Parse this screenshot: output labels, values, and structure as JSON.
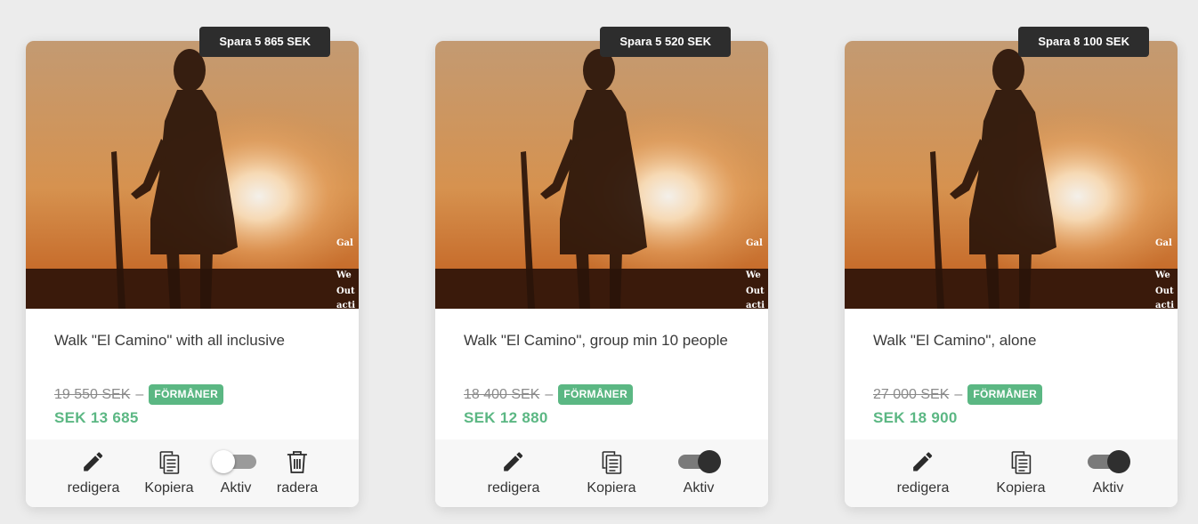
{
  "colors": {
    "accent_green": "#5bb783",
    "badge_dark": "#2d2d2d",
    "text": "#3a3a3a"
  },
  "cards": [
    {
      "save_badge": "Spara 5 865 SEK",
      "image_text": [
        "Gal",
        "We",
        "Out",
        "acti"
      ],
      "title": "Walk \"El Camino\" with all inclusive",
      "old_price": "19 550 SEK",
      "dash": "–",
      "perks_badge": "FÖRMÅNER",
      "new_price": "SEK 13 685",
      "actions": {
        "edit": "redigera",
        "copy": "Kopiera",
        "active": "Aktiv",
        "delete": "radera",
        "active_toggle": "off",
        "edit_icon": "pencil-icon",
        "copy_icon": "copy-document-icon",
        "delete_icon": "trash-icon"
      }
    },
    {
      "save_badge": "Spara 5 520 SEK",
      "image_text": [
        "Gal",
        "We",
        "Out",
        "acti"
      ],
      "title": "Walk \"El Camino\", group min 10 people",
      "old_price": "18 400 SEK",
      "dash": "–",
      "perks_badge": "FÖRMÅNER",
      "new_price": "SEK 12 880",
      "actions": {
        "edit": "redigera",
        "copy": "Kopiera",
        "active": "Aktiv",
        "active_toggle": "on",
        "edit_icon": "pencil-icon",
        "copy_icon": "copy-document-icon"
      }
    },
    {
      "save_badge": "Spara 8 100 SEK",
      "image_text": [
        "Gal",
        "We",
        "Out",
        "acti"
      ],
      "title": "Walk \"El Camino\", alone",
      "old_price": "27 000 SEK",
      "dash": "–",
      "perks_badge": "FÖRMÅNER",
      "new_price": "SEK 18 900",
      "actions": {
        "edit": "redigera",
        "copy": "Kopiera",
        "active": "Aktiv",
        "active_toggle": "on",
        "edit_icon": "pencil-icon",
        "copy_icon": "copy-document-icon"
      }
    }
  ]
}
